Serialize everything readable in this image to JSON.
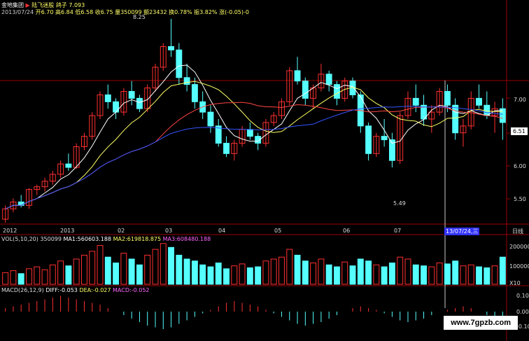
{
  "header": {
    "stock_name": "金地集团",
    "line1_prefix": "开6.70 高6.84 低6.58 收6.75 量350099 额23432 换0.78% 振3.82% 涨(-0.05)-0",
    "line1_title": "陆飞迷股 鸽子 7.093",
    "line2": "2013/07/24"
  },
  "price_axis": {
    "ticks": [
      "7.00",
      "6.51",
      "6.00",
      "5.50"
    ],
    "label_high": "8.25",
    "label_low": "5.49"
  },
  "date_axis": {
    "labels": [
      "2012",
      "2013",
      "02",
      "03",
      "04",
      "05",
      "06",
      "07"
    ],
    "cursor_label": "13/07/24,三",
    "period_label": "日线"
  },
  "vol_panel": {
    "title": "VOL(5,10,20)",
    "value": "350099",
    "ma1": "MA1:560603.188",
    "ma2": "MA2:619818.875",
    "ma3": "MA3:608480.188",
    "ticks": [
      "200000",
      "100000",
      "X10"
    ]
  },
  "macd_panel": {
    "title": "MACD(26,12,9)",
    "diff": "DIFF:-0.053",
    "dea": "DEA:-0.027",
    "macd": "MACD:-0.052",
    "ticks": [
      "0.10",
      "0.00",
      "-0.10"
    ]
  },
  "watermark": "www.7gpzb.com",
  "colors": {
    "up": "#ff3030",
    "down": "#55ffff",
    "green": "#33ff33",
    "ma_white": "#ffffff",
    "ma_yellow": "#ffff66",
    "ma_red": "#ff4444",
    "ma_blue": "#3355ff",
    "grid": "#990000"
  },
  "chart_data": {
    "type": "candlestick",
    "price_ylim": [
      5.3,
      8.3
    ],
    "candles": [
      [
        5.35,
        5.55,
        5.3,
        5.5
      ],
      [
        5.5,
        5.65,
        5.45,
        5.6
      ],
      [
        5.6,
        5.7,
        5.52,
        5.55
      ],
      [
        5.55,
        5.8,
        5.5,
        5.78
      ],
      [
        5.78,
        5.85,
        5.7,
        5.82
      ],
      [
        5.82,
        5.95,
        5.75,
        5.9
      ],
      [
        5.9,
        6.05,
        5.85,
        6.0
      ],
      [
        6.0,
        6.2,
        5.95,
        6.15
      ],
      [
        6.15,
        6.3,
        6.05,
        6.1
      ],
      [
        6.1,
        6.45,
        6.08,
        6.4
      ],
      [
        6.4,
        6.6,
        6.35,
        6.55
      ],
      [
        6.55,
        6.9,
        6.5,
        6.85
      ],
      [
        6.85,
        7.2,
        6.8,
        7.15
      ],
      [
        7.15,
        7.3,
        6.95,
        7.05
      ],
      [
        7.05,
        7.1,
        6.8,
        6.9
      ],
      [
        6.9,
        7.25,
        6.85,
        7.2
      ],
      [
        7.2,
        7.35,
        7.0,
        7.1
      ],
      [
        7.1,
        7.15,
        6.9,
        6.95
      ],
      [
        6.95,
        7.3,
        6.9,
        7.25
      ],
      [
        7.25,
        7.6,
        7.2,
        7.55
      ],
      [
        7.55,
        7.9,
        7.5,
        7.85
      ],
      [
        7.85,
        8.25,
        7.7,
        7.8
      ],
      [
        7.8,
        7.9,
        7.3,
        7.4
      ],
      [
        7.4,
        7.6,
        7.2,
        7.3
      ],
      [
        7.3,
        7.4,
        6.95,
        7.05
      ],
      [
        7.05,
        7.2,
        6.8,
        6.9
      ],
      [
        6.9,
        7.0,
        6.6,
        6.7
      ],
      [
        6.7,
        6.8,
        6.4,
        6.45
      ],
      [
        6.45,
        6.55,
        6.25,
        6.3
      ],
      [
        6.3,
        6.5,
        6.2,
        6.45
      ],
      [
        6.45,
        6.7,
        6.4,
        6.65
      ],
      [
        6.65,
        6.75,
        6.5,
        6.55
      ],
      [
        6.55,
        6.6,
        6.35,
        6.45
      ],
      [
        6.45,
        6.8,
        6.4,
        6.75
      ],
      [
        6.75,
        6.9,
        6.7,
        6.85
      ],
      [
        6.85,
        7.1,
        6.8,
        7.05
      ],
      [
        7.05,
        7.55,
        7.0,
        7.5
      ],
      [
        7.5,
        7.7,
        7.3,
        7.35
      ],
      [
        7.35,
        7.4,
        7.0,
        7.1
      ],
      [
        7.1,
        7.3,
        6.95,
        7.25
      ],
      [
        7.25,
        7.6,
        7.2,
        7.45
      ],
      [
        7.45,
        7.5,
        7.2,
        7.3
      ],
      [
        7.3,
        7.35,
        7.0,
        7.1
      ],
      [
        7.1,
        7.4,
        7.05,
        7.35
      ],
      [
        7.35,
        7.4,
        7.1,
        7.15
      ],
      [
        7.15,
        7.2,
        6.6,
        6.7
      ],
      [
        6.7,
        6.75,
        6.2,
        6.3
      ],
      [
        6.3,
        6.6,
        6.25,
        6.55
      ],
      [
        6.55,
        6.8,
        6.4,
        6.5
      ],
      [
        6.5,
        6.6,
        6.1,
        6.2
      ],
      [
        6.2,
        6.9,
        6.15,
        6.85
      ],
      [
        6.85,
        7.2,
        6.8,
        7.1
      ],
      [
        7.1,
        7.3,
        6.9,
        7.0
      ],
      [
        7.0,
        7.15,
        6.7,
        6.8
      ],
      [
        6.8,
        7.0,
        6.6,
        6.9
      ],
      [
        6.9,
        7.25,
        6.85,
        7.2
      ],
      [
        7.2,
        7.3,
        6.9,
        7.0
      ],
      [
        7.0,
        7.1,
        6.5,
        6.6
      ],
      [
        6.6,
        6.8,
        6.4,
        6.7
      ],
      [
        6.7,
        7.2,
        6.65,
        7.1
      ],
      [
        7.1,
        7.3,
        6.95,
        7.0
      ],
      [
        7.0,
        7.2,
        6.8,
        6.85
      ],
      [
        6.85,
        7.05,
        6.6,
        6.95
      ],
      [
        6.95,
        7.1,
        6.5,
        6.75
      ]
    ],
    "volumes": [
      60000,
      70000,
      55000,
      80000,
      90000,
      75000,
      100000,
      120000,
      95000,
      130000,
      150000,
      170000,
      200000,
      140000,
      110000,
      160000,
      130000,
      100000,
      150000,
      180000,
      210000,
      190000,
      150000,
      130000,
      120000,
      100000,
      90000,
      110000,
      80000,
      95000,
      105000,
      85000,
      90000,
      120000,
      130000,
      140000,
      180000,
      150000,
      120000,
      110000,
      130000,
      100000,
      90000,
      115000,
      95000,
      130000,
      120000,
      100000,
      90000,
      110000,
      140000,
      130000,
      100000,
      95000,
      90000,
      110000,
      105000,
      120000,
      95000,
      100000,
      90000,
      85000,
      95000,
      140000
    ],
    "macd_hist": [
      0.02,
      0.03,
      0.04,
      0.05,
      0.06,
      0.07,
      0.08,
      0.09,
      0.08,
      0.07,
      0.06,
      0.05,
      0.04,
      0.02,
      0.0,
      -0.02,
      -0.04,
      -0.06,
      -0.08,
      -0.09,
      -0.1,
      -0.09,
      -0.07,
      -0.05,
      -0.03,
      -0.01,
      0.01,
      0.03,
      0.05,
      0.06,
      0.05,
      0.04,
      0.03,
      0.01,
      -0.01,
      -0.03,
      -0.05,
      -0.07,
      -0.08,
      -0.07,
      -0.06,
      -0.04,
      -0.02,
      0.0,
      0.02,
      0.03,
      0.02,
      0.01,
      -0.01,
      -0.03,
      -0.05,
      -0.06,
      -0.05,
      -0.04,
      -0.02,
      0.0,
      0.01,
      0.02,
      0.03,
      0.02,
      0.0,
      -0.02,
      -0.04,
      -0.05
    ]
  }
}
